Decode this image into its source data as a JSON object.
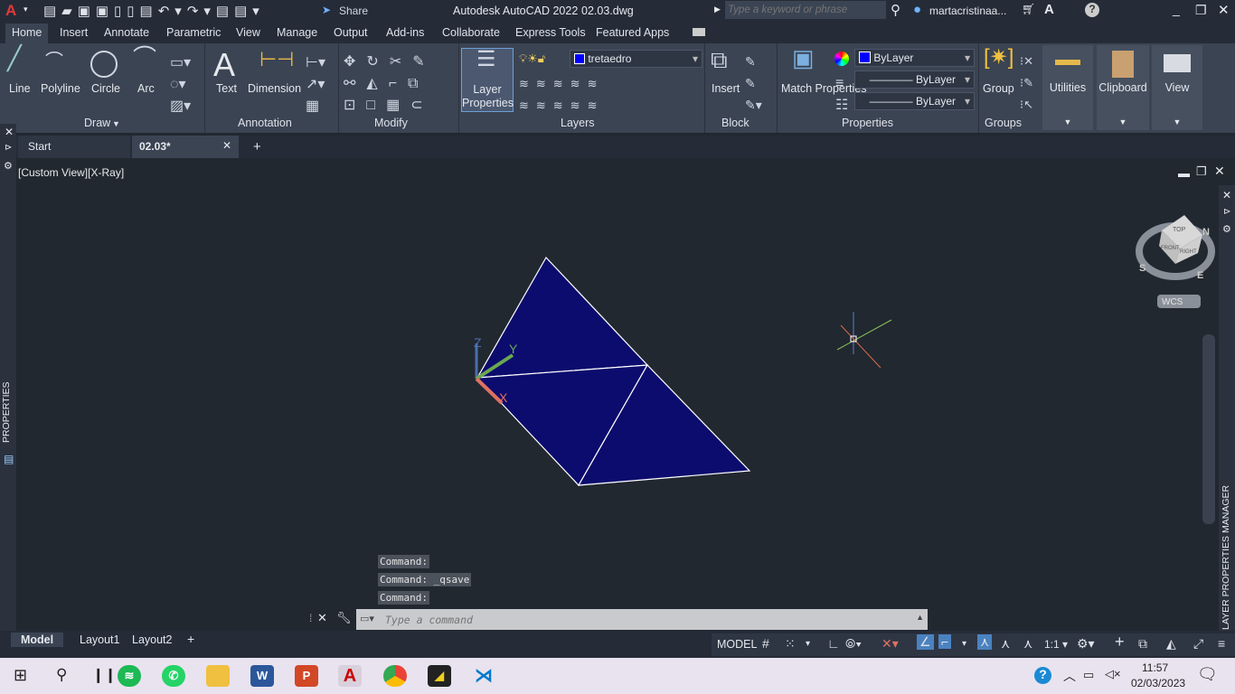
{
  "title_bar": {
    "app_title": "Autodesk AutoCAD 2022",
    "file": "02.03.dwg",
    "share": "Share",
    "search_placeholder": "Type a keyword or phrase",
    "user": "martacristinaa..."
  },
  "ribbon_tabs": [
    "Home",
    "Insert",
    "Annotate",
    "Parametric",
    "View",
    "Manage",
    "Output",
    "Add-ins",
    "Collaborate",
    "Express Tools",
    "Featured Apps"
  ],
  "panels": {
    "draw": {
      "title": "Draw",
      "tools": [
        "Line",
        "Polyline",
        "Circle",
        "Arc"
      ]
    },
    "annotation": {
      "title": "Annotation",
      "tools": [
        "Text",
        "Dimension"
      ]
    },
    "modify": {
      "title": "Modify"
    },
    "layers": {
      "title": "Layers",
      "layer_properties": "Layer Properties",
      "current_layer": "tretaedro",
      "layer_color": "#0000ff"
    },
    "block": {
      "title": "Block",
      "insert": "Insert"
    },
    "properties": {
      "title": "Properties",
      "match": "Match Properties",
      "color": "ByLayer",
      "linetype": "ByLayer",
      "lineweight": "ByLayer"
    },
    "groups": {
      "title": "Groups",
      "group": "Group"
    },
    "utilities": "Utilities",
    "clipboard": "Clipboard",
    "view": "View"
  },
  "doc_tabs": [
    {
      "label": "Start"
    },
    {
      "label": "02.03*",
      "active": true
    }
  ],
  "viewport": {
    "label": "[Custom View][X-Ray]",
    "wcs": "WCS",
    "viewcube": {
      "top": "TOP",
      "right": "RIGHT",
      "front": "FRONT",
      "n": "N",
      "s": "S",
      "e": "E"
    },
    "ucs": {
      "x": "X",
      "y": "Y",
      "z": "Z"
    },
    "face_color": "#0c0c6e"
  },
  "side_palettes": {
    "properties": "PROPERTIES",
    "layer_manager": "LAYER PROPERTIES MANAGER"
  },
  "command_history": [
    "Command:",
    "Command: _qsave",
    "Command:"
  ],
  "command_placeholder": "Type a command",
  "layout_tabs": [
    "Model",
    "Layout1",
    "Layout2"
  ],
  "status": {
    "model": "MODEL",
    "scale": "1:1"
  },
  "taskbar": {
    "time": "11:57",
    "date": "02/03/2023"
  }
}
